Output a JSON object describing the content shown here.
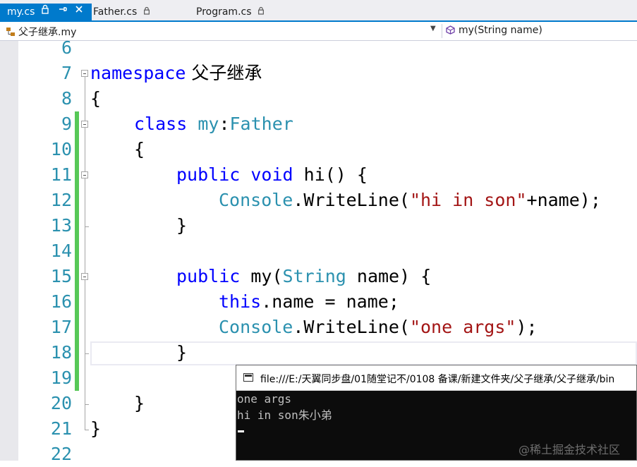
{
  "tabs": [
    {
      "label": "my.cs",
      "icons": [
        "lock-icon",
        "pin-icon",
        "close-icon"
      ],
      "active": true
    },
    {
      "label": "Father.cs",
      "icons": [
        "lock-icon"
      ],
      "active": false
    },
    {
      "label": "Program.cs",
      "icons": [
        "lock-icon"
      ],
      "active": false
    }
  ],
  "nav": {
    "class_selector": "父子继承.my",
    "member_selector": "my(String name)"
  },
  "editor": {
    "line_numbers": [
      "6",
      "7",
      "8",
      "9",
      "10",
      "11",
      "12",
      "13",
      "14",
      "15",
      "16",
      "17",
      "18",
      "19",
      "20",
      "21",
      "22"
    ],
    "code": {
      "l7_kw": "namespace",
      "l7_name": " 父子继承",
      "l8": "{",
      "l9_kw": "class",
      "l9_ty1": "my",
      "l9_colon": ":",
      "l9_ty2": "Father",
      "l10": "{",
      "l11_kw1": "public",
      "l11_kw2": "void",
      "l11_rest": " hi() {",
      "l12_ty": "Console",
      "l12_mid": ".WriteLine(",
      "l12_str": "\"hi in son\"",
      "l12_end": "+name);",
      "l13": "}",
      "l15_kw": "public",
      "l15_mid": " my(",
      "l15_ty": "String",
      "l15_end": " name) {",
      "l16_kw": "this",
      "l16_end": ".name = name;",
      "l17_ty": "Console",
      "l17_mid": ".WriteLine(",
      "l17_str": "\"one args\"",
      "l17_end": ");",
      "l18": "}",
      "l20": "}",
      "l21": "}"
    }
  },
  "console": {
    "title": "file:///E:/天翼同步盘/01随堂记不/0108 备课/新建文件夹/父子继承/父子继承/bin",
    "lines": [
      "one args",
      "hi in son朱小弟"
    ]
  },
  "watermark": "@稀土掘金技术社区",
  "colors": {
    "accent": "#007acc",
    "keyword": "#0000ff",
    "type": "#2b91af",
    "string": "#a31515",
    "line_number": "#2b91af",
    "change_bar": "#57c857"
  }
}
